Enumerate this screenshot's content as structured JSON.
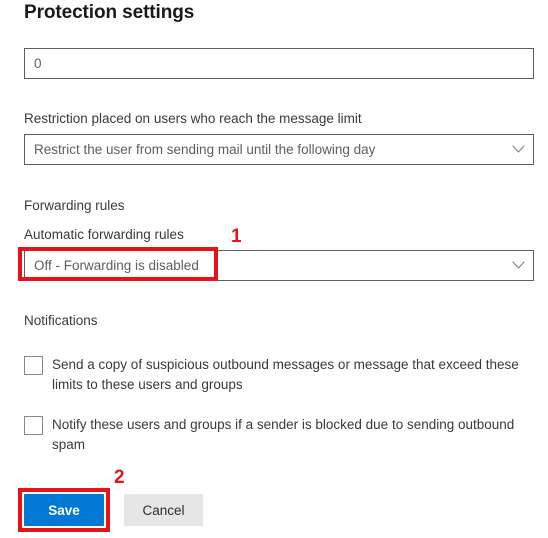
{
  "page": {
    "title": "Protection settings"
  },
  "fields": {
    "message_limit": {
      "value": "0",
      "placeholder": "0"
    },
    "restriction": {
      "label": "Restriction placed on users who reach the message limit",
      "value": "Restrict the user from sending mail until the following day",
      "chevron_icon": "chevron-down-icon"
    }
  },
  "forwarding": {
    "section_label": "Forwarding rules",
    "field_label": "Automatic forwarding rules",
    "value": "Off - Forwarding is disabled",
    "chevron_icon": "chevron-down-icon"
  },
  "notifications": {
    "section_label": "Notifications",
    "items": [
      {
        "label": "Send a copy of suspicious outbound messages or message that exceed these limits to these users and groups",
        "checked": false
      },
      {
        "label": "Notify these users and groups if a sender is blocked due to sending outbound spam",
        "checked": false
      }
    ]
  },
  "actions": {
    "save_label": "Save",
    "cancel_label": "Cancel"
  },
  "annotations": {
    "accent_color": "#e8121a",
    "markers": [
      {
        "number": "1",
        "target": "automatic-forwarding-rules-dropdown"
      },
      {
        "number": "2",
        "target": "save-button"
      }
    ]
  },
  "colors": {
    "primary_button": "#0078d4",
    "secondary_button": "#e6e6e6",
    "annotation_red": "#e8121a",
    "field_border": "#605e5c",
    "text": "#3b3a39"
  }
}
